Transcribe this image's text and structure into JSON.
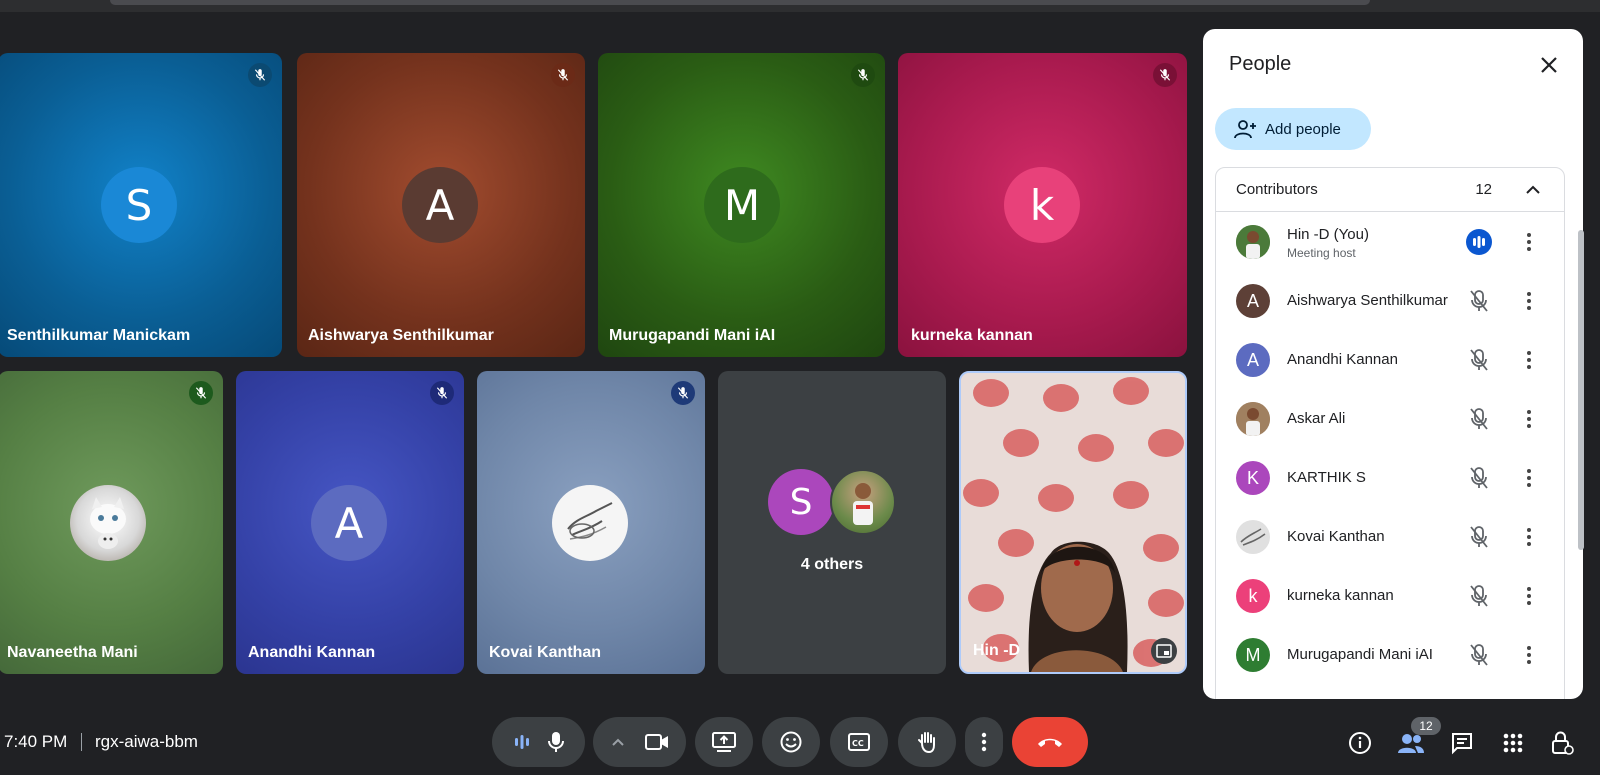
{
  "tiles": [
    {
      "name": "Senthilkumar Manickam",
      "initial": "S",
      "bg": "#0a6aa8",
      "avatar_color": "#1a88d6"
    },
    {
      "name": "Aishwarya Senthilkumar",
      "initial": "A",
      "bg": "#7a3520",
      "avatar_color": "#5a3b32"
    },
    {
      "name": "Murugapandi Mani iAI",
      "initial": "M",
      "bg": "#2d6415",
      "avatar_color": "#2e6b1c"
    },
    {
      "name": "kurneka kannan",
      "initial": "k",
      "bg": "#b0184f",
      "avatar_color": "#e8417a"
    },
    {
      "name": "Navaneetha Mani",
      "initial": "",
      "bg": "#5d8a4c",
      "avatar_color": "#d0d0d0"
    },
    {
      "name": "Anandhi Kannan",
      "initial": "A",
      "bg": "#3946a8",
      "avatar_color": "#5c6bc0"
    },
    {
      "name": "Kovai Kanthan",
      "initial": "",
      "bg": "#6f85a8",
      "avatar_color": "#f1f1f1"
    },
    {
      "name": "Hin -D",
      "initial": "",
      "bg": "#d9c8c4",
      "avatar_color": "#c44"
    }
  ],
  "others": {
    "initial": "S",
    "label": "4 others"
  },
  "panel": {
    "title": "People",
    "add_label": "Add people",
    "section_label": "Contributors",
    "section_count": "12",
    "people": [
      {
        "name": "Hin -D (You)",
        "sub": "Meeting host",
        "initial": "",
        "color": "#4b7a3a"
      },
      {
        "name": "Aishwarya Senthilkumar",
        "initial": "A",
        "color": "#5d4037"
      },
      {
        "name": "Anandhi Kannan",
        "initial": "A",
        "color": "#5c6bc0"
      },
      {
        "name": "Askar Ali",
        "initial": "",
        "color": "#a08060"
      },
      {
        "name": "KARTHIK S",
        "initial": "K",
        "color": "#ab47bc"
      },
      {
        "name": "Kovai Kanthan",
        "initial": "",
        "color": "#e0e0e0"
      },
      {
        "name": "kurneka kannan",
        "initial": "k",
        "color": "#ec407a"
      },
      {
        "name": "Murugapandi Mani iAI",
        "initial": "M",
        "color": "#2e7d32"
      }
    ]
  },
  "bottom": {
    "time": "7:40 PM",
    "meeting_code": "rgx-aiwa-bbm",
    "people_badge": "12"
  }
}
